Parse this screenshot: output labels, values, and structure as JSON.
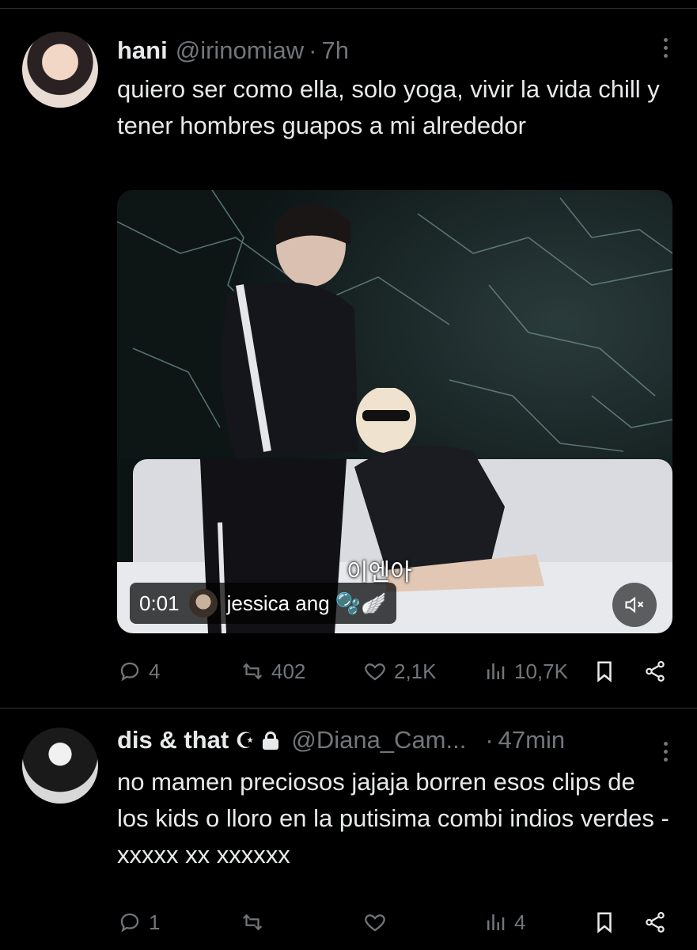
{
  "tweet1": {
    "name": "hani",
    "handle": "@irinomiaw",
    "dot": "·",
    "time": "7h",
    "text": "quiero ser como ella, solo yoga, vivir la vida chill y tener hombres guapos a mi alrededor",
    "media": {
      "caption": "이엔아",
      "timestamp": "0:01",
      "uploader": "jessica ang 🫧🪽"
    },
    "actions": {
      "replies": "4",
      "retweets": "402",
      "likes": "2,1K",
      "views": "10,7K"
    }
  },
  "tweet2": {
    "name": "dis & that",
    "badge": "☪",
    "handle": "@Diana_Cam...",
    "dot": "·",
    "time": "47min",
    "text": "no mamen preciosos jajaja borren esos clips de los kids o lloro en la putisima combi indios verdes - xxxxx xx xxxxxx",
    "actions": {
      "replies": "1",
      "retweets": "",
      "likes": "",
      "views": "4"
    }
  },
  "colors": {
    "background": "#000000",
    "text": "#e7e9ea",
    "muted": "#71767b",
    "divider": "#2f3336"
  }
}
